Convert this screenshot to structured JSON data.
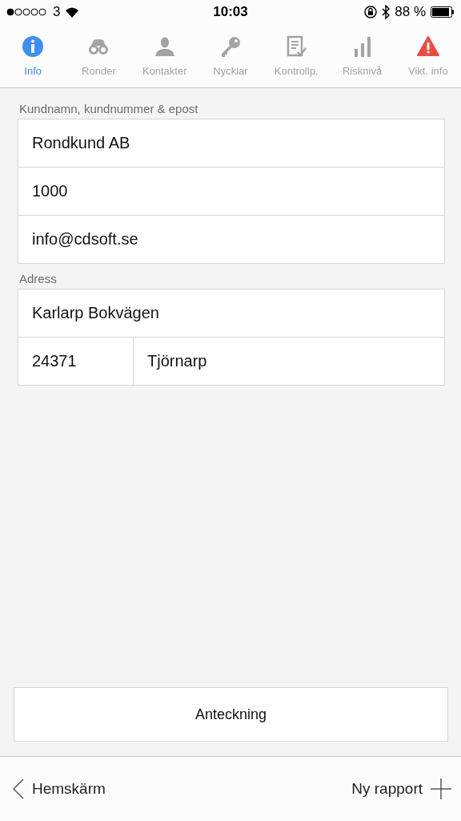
{
  "status_bar": {
    "carrier": "3",
    "time": "10:03",
    "battery": "88 %"
  },
  "tabs": [
    {
      "label": "Info",
      "kind": "info",
      "selected": true
    },
    {
      "label": "Ronder",
      "kind": "binoculars",
      "selected": false
    },
    {
      "label": "Kontakter",
      "kind": "person",
      "selected": false
    },
    {
      "label": "Nycklar",
      "kind": "key",
      "selected": false
    },
    {
      "label": "Kontrollp.",
      "kind": "checklist",
      "selected": false
    },
    {
      "label": "Risknivå",
      "kind": "bars",
      "selected": false
    },
    {
      "label": "Vikt. info",
      "kind": "warning",
      "selected": false
    }
  ],
  "sections": [
    {
      "label": "Kundnamn, kundnummer & epost",
      "rows": [
        [
          "Rondkund AB"
        ],
        [
          "1000"
        ],
        [
          "info@cdsoft.se"
        ]
      ]
    },
    {
      "label": "Adress",
      "rows": [
        [
          "Karlarp Bokvägen"
        ],
        [
          "24371",
          "Tjörnarp"
        ]
      ]
    }
  ],
  "note_button": "Anteckning",
  "footer": {
    "back": "Hemskärm",
    "new_report": "Ny rapport"
  }
}
